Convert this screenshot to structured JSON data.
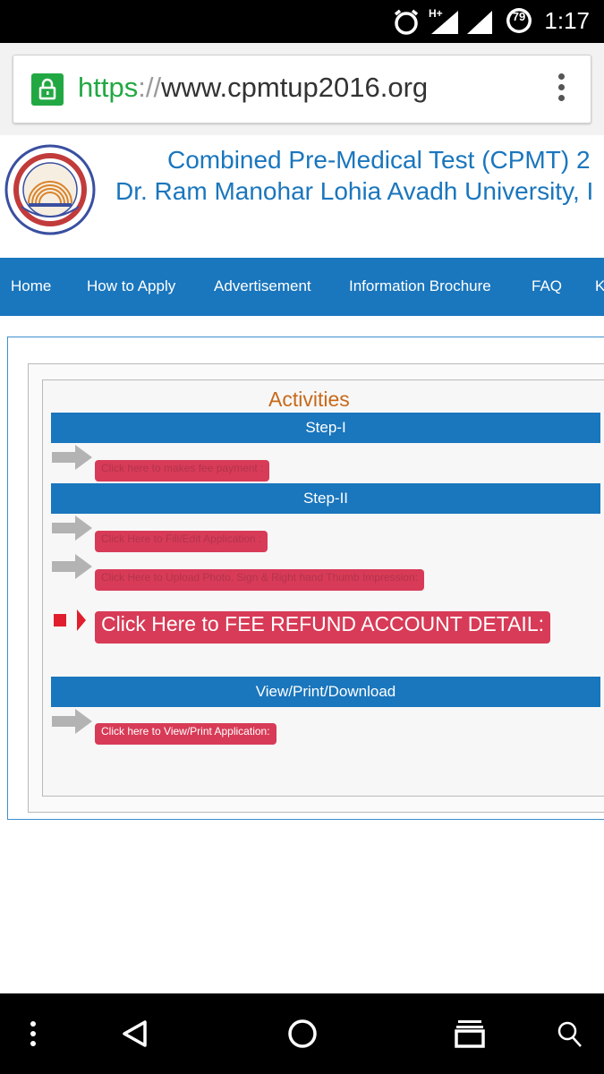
{
  "status_bar": {
    "time": "1:17",
    "battery_level": "79",
    "network_type": "H+",
    "icons": [
      "alarm-icon",
      "signal-icon",
      "signal-icon",
      "battery-icon"
    ]
  },
  "browser": {
    "url_scheme": "https",
    "url_separator": "://",
    "url_host": "www.cpmtup2016.org",
    "lock_icon": "lock-icon",
    "menu_icon": "kebab-menu-icon"
  },
  "header": {
    "title_line1": "Combined Pre-Medical Test (CPMT) 2",
    "title_line2": "Dr. Ram Manohar Lohia Avadh University, I",
    "logo_icon": "university-seal-icon"
  },
  "nav": {
    "items": [
      {
        "label": "Home"
      },
      {
        "label": "How to Apply"
      },
      {
        "label": "Advertisement"
      },
      {
        "label": "Information Brochure"
      },
      {
        "label": "FAQ"
      },
      {
        "label": "K"
      }
    ]
  },
  "activities": {
    "heading": "Activities",
    "step1": {
      "title": "Step-I",
      "links": [
        "Click here to makes fee payment :"
      ]
    },
    "step2": {
      "title": "Step-II",
      "links": [
        "Click Here to Fill/Edit Application :",
        "Click Here to Upload Photo, Sign & Right hand Thumb Impression:"
      ]
    },
    "refund_link": "Click Here to FEE REFUND ACCOUNT DETAIL:",
    "view": {
      "title": "View/Print/Download",
      "links": [
        "Click here to View/Print Application:"
      ]
    }
  },
  "colors": {
    "brand_blue": "#1a76bd",
    "link_red": "#d83b57",
    "activities_orange": "#c7691a",
    "secure_green": "#22a843"
  },
  "android_nav": {
    "icons": [
      "menu-dots-icon",
      "back-icon",
      "home-icon",
      "recents-icon",
      "search-icon"
    ]
  }
}
